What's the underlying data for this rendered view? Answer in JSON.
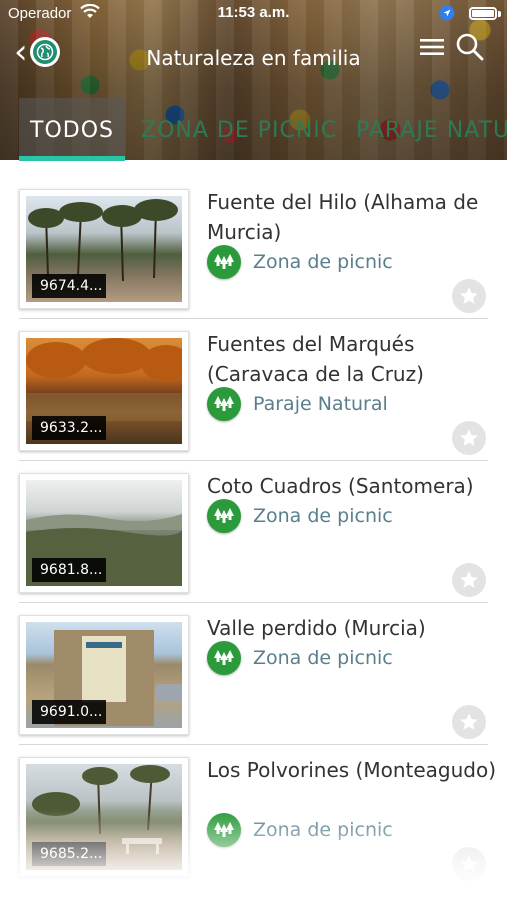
{
  "status_bar": {
    "carrier": "Operador",
    "time": "11:53 a.m."
  },
  "header": {
    "title": "Naturaleza en familia",
    "back_icon": "chevron-left-icon",
    "globe_icon": "globe-icon",
    "menu_icon": "hamburger-menu-icon",
    "search_icon": "search-icon"
  },
  "tabs": [
    {
      "label": "TODOS",
      "active": true
    },
    {
      "label": "ZONA DE PICNIC",
      "active": false
    },
    {
      "label": "PARAJE NATU",
      "active": false
    }
  ],
  "colors": {
    "accent": "#2bc4a6",
    "category_green": "#2a9a3a",
    "category_text": "#5a7f8c",
    "inactive_tab": "#2e7a55"
  },
  "items": [
    {
      "title": "Fuente del Hilo (Alhama de Murcia)",
      "distance": "9674.4...",
      "category": "Zona de picnic",
      "category_icon": "picnic-trees-icon",
      "favorite_icon": "star-icon"
    },
    {
      "title": "Fuentes del Marqués (Caravaca de la Cruz)",
      "distance": "9633.2...",
      "category": "Paraje Natural",
      "category_icon": "picnic-trees-icon",
      "favorite_icon": "star-icon"
    },
    {
      "title": "Coto Cuadros (Santomera)",
      "distance": "9681.8...",
      "category": "Zona de picnic",
      "category_icon": "picnic-trees-icon",
      "favorite_icon": "star-icon"
    },
    {
      "title": "Valle perdido (Murcia)",
      "distance": "9691.0...",
      "category": "Zona de picnic",
      "category_icon": "picnic-trees-icon",
      "favorite_icon": "star-icon"
    },
    {
      "title": "Los Polvorines (Monteagudo)",
      "distance": "9685.2...",
      "category": "Zona de picnic",
      "category_icon": "picnic-trees-icon",
      "favorite_icon": "star-icon"
    }
  ]
}
